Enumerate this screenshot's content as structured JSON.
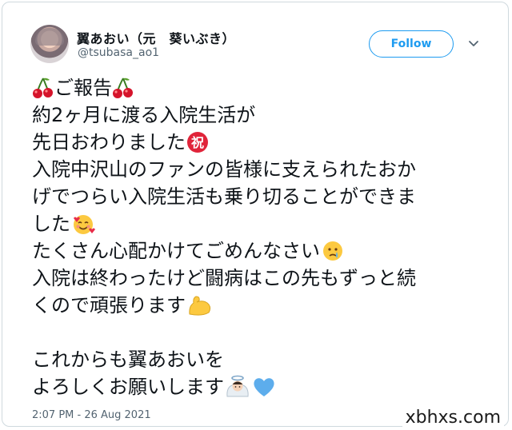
{
  "author": {
    "display_name": "翼あおい（元　葵いぶき）",
    "handle": "@tsubasa_ao1"
  },
  "follow_button": {
    "label": "Follow"
  },
  "more_menu_icon": "chevron-down-icon",
  "tweet": {
    "lines": [
      {
        "parts": [
          "cherry-icon",
          "ご報告",
          "cherry-icon"
        ]
      },
      {
        "parts": [
          "約2ヶ月に渡る入院生活が"
        ]
      },
      {
        "parts": [
          "先日おわりました",
          "congratulations-icon"
        ]
      },
      {
        "parts": [
          "入院中沢山のファンの皆様に支えられたおか"
        ]
      },
      {
        "parts": [
          "げでつらい入院生活も乗り切ることができま"
        ]
      },
      {
        "parts": [
          "した",
          "smiling-face-with-hearts-icon"
        ]
      },
      {
        "parts": [
          "たくさん心配かけてごめんなさい",
          "crying-face-icon"
        ]
      },
      {
        "parts": [
          "入院は終わったけど闘病はこの先もずっと続"
        ]
      },
      {
        "parts": [
          "くので頑張ります",
          "flexed-biceps-icon"
        ]
      },
      {
        "parts": []
      },
      {
        "parts": [
          "これからも翼あおいを"
        ]
      },
      {
        "parts": [
          "よろしくお願いします",
          "angel-icon",
          "blue-heart-icon"
        ]
      }
    ]
  },
  "timestamp": "2:07 PM - 26 Aug 2021",
  "watermark": "xbhxs.com",
  "colors": {
    "accent": "#1d9bf0",
    "text": "#0f1419",
    "secondary_text": "#536471",
    "border": "#cfd9de"
  }
}
